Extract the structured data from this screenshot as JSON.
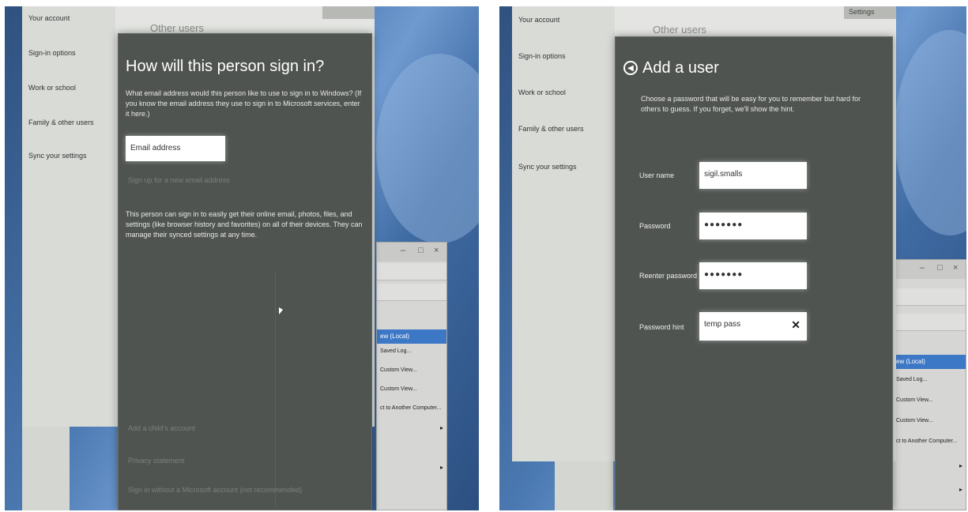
{
  "left": {
    "nav": [
      "Your account",
      "Sign-in options",
      "Work or school",
      "Family & other users",
      "Sync your settings"
    ],
    "other_users_title": "Other users",
    "dialog": {
      "heading": "How will this person sign in?",
      "intro": "What email address would this person like to use to sign in to Windows? (If you know the email address they use to sign in to Microsoft services, enter it here.)",
      "email_placeholder": "Email address",
      "signup_link": "Sign up for a new email address",
      "body": "This person can sign in to easily get their online email, photos, files, and settings (like browser history and favorites) on all of their devices. They can manage their synced settings at any time.",
      "link_child": "Add a child's account",
      "link_privacy": "Privacy statement",
      "link_local": "Sign in without a Microsoft account (not recommended)"
    },
    "bg_app": {
      "window_buttons": [
        "–",
        "□",
        "×"
      ],
      "selected": "ew (Local)",
      "items": [
        "Saved Log...",
        "Custom View...",
        "Custom View...",
        "ct to Another Computer..."
      ]
    }
  },
  "right": {
    "nav": [
      "Your account",
      "Sign-in options",
      "Work or school",
      "Family & other users",
      "Sync your settings"
    ],
    "other_users_title": "Other users",
    "title_strip_text": "Settings",
    "dialog": {
      "heading": "Add a user",
      "intro": "Choose a password that will be easy for you to remember but hard for others to guess. If you forget, we'll show the hint.",
      "fields": [
        {
          "label": "User name",
          "value": "sigil.smalls"
        },
        {
          "label": "Password",
          "value": "●●●●●●●"
        },
        {
          "label": "Reenter password",
          "value": "●●●●●●●"
        },
        {
          "label": "Password hint",
          "value": "temp pass"
        }
      ],
      "clear_symbol": "✕"
    },
    "bg_app": {
      "window_buttons": [
        "–",
        "□",
        "×"
      ],
      "selected": "ew (Local)",
      "items": [
        "Saved Log...",
        "Custom View...",
        "Custom View...",
        "ct to Another Computer..."
      ]
    }
  }
}
